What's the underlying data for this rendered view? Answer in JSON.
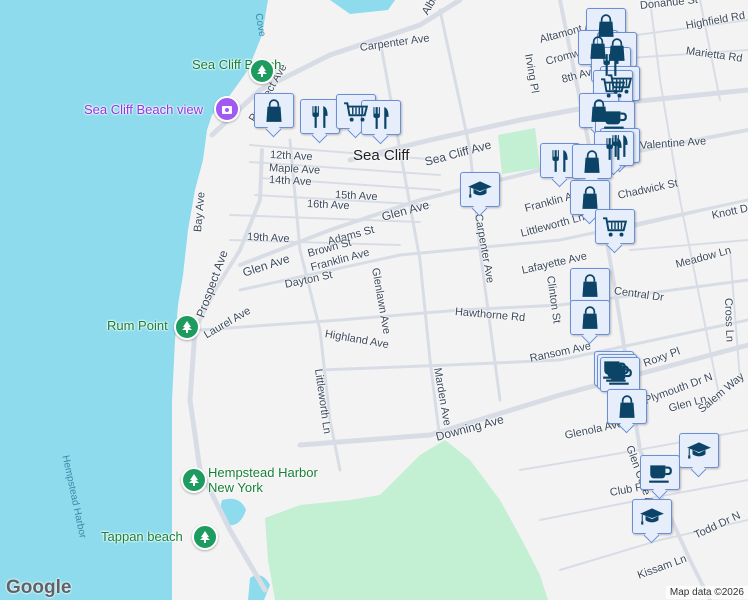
{
  "map": {
    "colors": {
      "water": "#8ddbec",
      "land": "#f4f3f4",
      "park": "#c3efd2",
      "road": "#d8dde5",
      "marker_icon": "#0b4466",
      "marker_bg": "#e6eefc"
    },
    "town_label": "Sea Cliff",
    "road_labels": [
      "Albertson Pl",
      "Carpenter Ave",
      "Prospect Ave",
      "12th Ave",
      "Maple Ave",
      "14th Ave",
      "15th Ave",
      "16th Ave",
      "Bay Ave",
      "19th Ave",
      "Glen Ave",
      "Adams St",
      "Brown St",
      "Franklin Ave",
      "Dayton St",
      "Sea Cliff Ave",
      "Glen Ave",
      "Carpenter Ave",
      "Franklin Ave",
      "Littleworth Ln",
      "Lafayette Ave",
      "Clinton St",
      "Glenlawn Ave",
      "Highland Ave",
      "Hawthorne Rd",
      "Laurel Ave",
      "Littleworth Ln",
      "Marden Ave",
      "Downing Ave",
      "Ransom Ave",
      "Central Dr",
      "Meadow Ln",
      "Knott Dr",
      "Chadwick St",
      "Valentine Ave",
      "Donahue St",
      "Highfield Rd",
      "Marietta Rd",
      "Altamont Ave",
      "Cromwell Pl",
      "Irving Pl",
      "8th Ave",
      "Cross Ln",
      "Glen Ln",
      "Salem Way",
      "Plymouth Dr N",
      "Glenola Ave",
      "Club Rd",
      "Todd Dr N",
      "Kissam Ln",
      "Glen Cove Ave",
      "Prospect Ave",
      "Roxy Pl"
    ],
    "water_labels": [
      "Cove",
      "Hempstead Harbor"
    ],
    "pois": [
      {
        "name": "Sea Cliff Beach",
        "type": "park",
        "icon": "tree-icon"
      },
      {
        "name": "Sea Cliff Beach view",
        "type": "photo",
        "icon": "camera-icon"
      },
      {
        "name": "Rum Point",
        "type": "park",
        "icon": "tree-icon"
      },
      {
        "name": "Hempstead Harbor New York",
        "type": "park",
        "icon": "tree-icon"
      },
      {
        "name": "Tappan beach",
        "type": "park",
        "icon": "tree-icon"
      }
    ],
    "markers": [
      "shopping",
      "restaurant",
      "grocery",
      "restaurant",
      "shopping",
      "shopping",
      "shopping",
      "restaurant",
      "grocery",
      "grocery",
      "shopping",
      "cafe",
      "restaurant",
      "restaurant",
      "restaurant",
      "shopping",
      "shopping",
      "grocery",
      "school",
      "shopping",
      "shopping",
      "cafe",
      "cafe",
      "cafe",
      "shopping",
      "cafe",
      "school",
      "school"
    ],
    "logo": "Google",
    "attribution": "Map data ©2026"
  }
}
